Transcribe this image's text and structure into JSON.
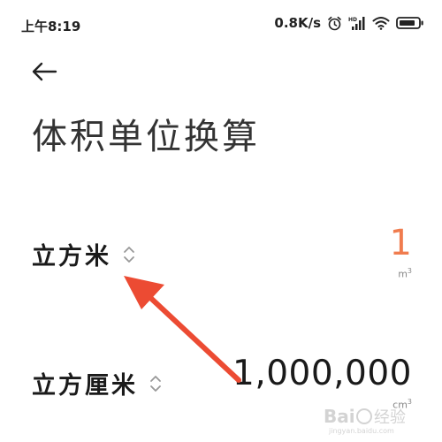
{
  "status_bar": {
    "time": "上午8:19",
    "net_speed": "0.8K/s",
    "icons": [
      "alarm-icon",
      "hd-signal-icon",
      "wifi-icon",
      "battery-icon"
    ]
  },
  "header": {
    "back_icon": "back-arrow-icon",
    "title": "体积单位换算"
  },
  "converter": {
    "from": {
      "unit_name": "立方米",
      "value": "1",
      "symbol": "m",
      "symbol_exp": "3",
      "icon": "sort-updown-icon"
    },
    "to": {
      "unit_name": "立方厘米",
      "value": "1,000,000",
      "symbol": "cm",
      "symbol_exp": "3",
      "icon": "sort-updown-icon"
    }
  },
  "colors": {
    "accent": "#f07c4e",
    "annotation": "#ec4b33"
  },
  "watermark": "Bai经验 jingyan.baidu.com"
}
